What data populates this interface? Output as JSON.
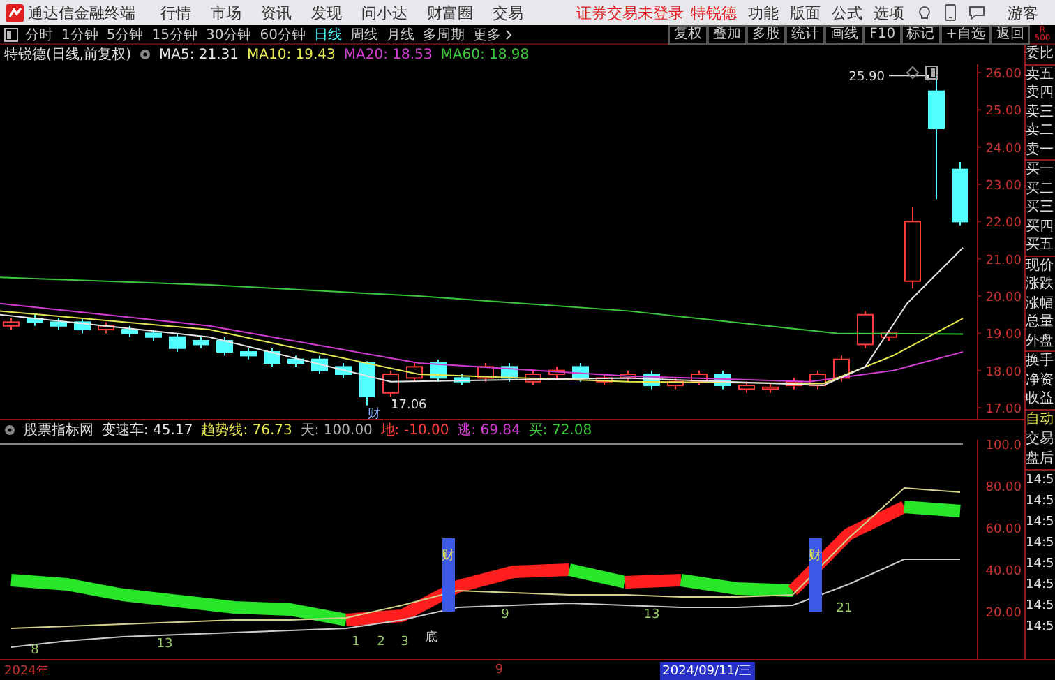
{
  "menubar": {
    "app_title": "通达信金融终端",
    "menu": [
      "行情",
      "市场",
      "资讯",
      "发现",
      "问小达",
      "财富圈",
      "交易"
    ],
    "notice": "证券交易未登录",
    "stock": "特锐德",
    "right_menu": [
      "功能",
      "版面",
      "公式",
      "选项"
    ],
    "user": "游客"
  },
  "toolbar": {
    "periods": [
      {
        "label": "分时",
        "selected": false
      },
      {
        "label": "1分钟",
        "selected": false
      },
      {
        "label": "5分钟",
        "selected": false
      },
      {
        "label": "15分钟",
        "selected": false
      },
      {
        "label": "30分钟",
        "selected": false
      },
      {
        "label": "60分钟",
        "selected": false
      },
      {
        "label": "日线",
        "selected": true
      },
      {
        "label": "周线",
        "selected": false
      },
      {
        "label": "月线",
        "selected": false
      },
      {
        "label": "多周期",
        "selected": false
      },
      {
        "label": "更多",
        "selected": false
      }
    ],
    "tools": [
      "复权",
      "叠加",
      "多股",
      "统计",
      "画线",
      "F10",
      "标记",
      "+自选",
      "返回"
    ],
    "badge": [
      "R",
      "500"
    ]
  },
  "main_chart": {
    "title": "特锐德(日线,前复权)",
    "indicators": [
      {
        "text": "MA5: 21.31",
        "color": "#e6e6e6"
      },
      {
        "text": "MA10: 19.43",
        "color": "#e6e650"
      },
      {
        "text": "MA20: 18.53",
        "color": "#d23cd2"
      },
      {
        "text": "MA60: 18.98",
        "color": "#3cc83c"
      }
    ],
    "price_ticks": [
      "26.00",
      "25.00",
      "24.00",
      "23.00",
      "22.00",
      "21.00",
      "20.00",
      "19.00",
      "18.00",
      "17.00"
    ],
    "annotations": [
      "25.90",
      "17.06",
      "财"
    ]
  },
  "sub_chart": {
    "title": "股票指标网",
    "indicators": [
      {
        "text": "变速车: 45.17",
        "color": "#e6e6e6"
      },
      {
        "text": "趋势线: 76.73",
        "color": "#e6e650"
      },
      {
        "text": "天: 100.00",
        "color": "#b4b4b4"
      },
      {
        "text": "地: -10.00",
        "color": "#ff4040"
      },
      {
        "text": "逃: 69.84",
        "color": "#d23cd2"
      },
      {
        "text": "买: 72.08",
        "color": "#3cc83c"
      }
    ],
    "chart_data": {
      "type": "line",
      "ylim": [
        0,
        100
      ],
      "yticks": [
        {
          "value": 100,
          "label": "100.0"
        },
        {
          "value": 80,
          "label": "80.00"
        },
        {
          "value": 60,
          "label": "60.00"
        },
        {
          "value": 40,
          "label": "40.00"
        },
        {
          "value": 20,
          "label": "20.00"
        }
      ],
      "series": [
        {
          "color": "#28e628",
          "values": [
            35,
            33,
            28,
            25,
            22,
            21,
            16,
            null,
            null,
            null,
            null,
            null,
            null,
            null,
            null,
            null,
            null,
            null
          ]
        },
        {
          "color": "#ff1e1e",
          "values": [
            null,
            null,
            null,
            null,
            null,
            null,
            16,
            18,
            32,
            39,
            40,
            null,
            null,
            null,
            null,
            null,
            null,
            null
          ]
        },
        {
          "color": "#28e628",
          "values": [
            null,
            null,
            null,
            null,
            null,
            null,
            null,
            null,
            null,
            null,
            40,
            34,
            null,
            null,
            null,
            null,
            null,
            null
          ]
        },
        {
          "color": "#ff1e1e",
          "values": [
            null,
            null,
            null,
            null,
            null,
            null,
            null,
            null,
            null,
            null,
            null,
            34,
            35,
            null,
            null,
            null,
            null,
            null
          ]
        },
        {
          "color": "#28e628",
          "values": [
            null,
            null,
            null,
            null,
            null,
            null,
            null,
            null,
            null,
            null,
            null,
            null,
            35,
            31,
            30,
            null,
            null,
            null
          ]
        },
        {
          "color": "#ff1e1e",
          "values": [
            null,
            null,
            null,
            null,
            null,
            null,
            null,
            null,
            null,
            null,
            null,
            null,
            null,
            null,
            30,
            57,
            70,
            null
          ]
        },
        {
          "color": "#28e628",
          "values": [
            null,
            null,
            null,
            null,
            null,
            null,
            null,
            null,
            null,
            null,
            null,
            null,
            null,
            null,
            null,
            null,
            70,
            68
          ]
        },
        {
          "color": "#d2d28c",
          "values": [
            12,
            13,
            14,
            15,
            16,
            16,
            17,
            23,
            30,
            29,
            28,
            28,
            27,
            27,
            28,
            55,
            79,
            77
          ]
        },
        {
          "color": "#cccccc",
          "values": [
            3,
            6,
            8,
            9,
            10,
            11,
            12,
            16,
            22,
            23,
            24,
            23,
            22,
            22,
            23,
            33,
            45,
            45
          ]
        }
      ]
    },
    "annotations": [
      "财",
      "财",
      "8",
      "13",
      "1",
      "2",
      "3",
      "底",
      "9",
      "13",
      "21"
    ]
  },
  "side_panel": {
    "quote_groups": [
      [
        "委比"
      ],
      [
        "卖五",
        "卖四",
        "卖三",
        "卖二",
        "卖一"
      ],
      [
        "买一",
        "买二",
        "买三",
        "买四",
        "买五"
      ],
      [
        "现价",
        "涨跌",
        "涨幅",
        "总量",
        "外盘"
      ],
      [
        "换手",
        "净资",
        "收益"
      ]
    ],
    "trade_labels": [
      {
        "text": "自动",
        "highlighted": true
      },
      {
        "text": "交易",
        "highlighted": false
      },
      {
        "text": "盘后",
        "highlighted": false
      }
    ],
    "times": [
      "14:5",
      "14:5",
      "14:5",
      "14:5",
      "14:5",
      "14:5",
      "14:5",
      "14:5"
    ]
  },
  "time_axis": [
    {
      "text": "2024年",
      "kind": "tick"
    },
    {
      "text": "9",
      "kind": "tick"
    },
    {
      "text": "2024/09/11/三",
      "kind": "cursor"
    }
  ]
}
